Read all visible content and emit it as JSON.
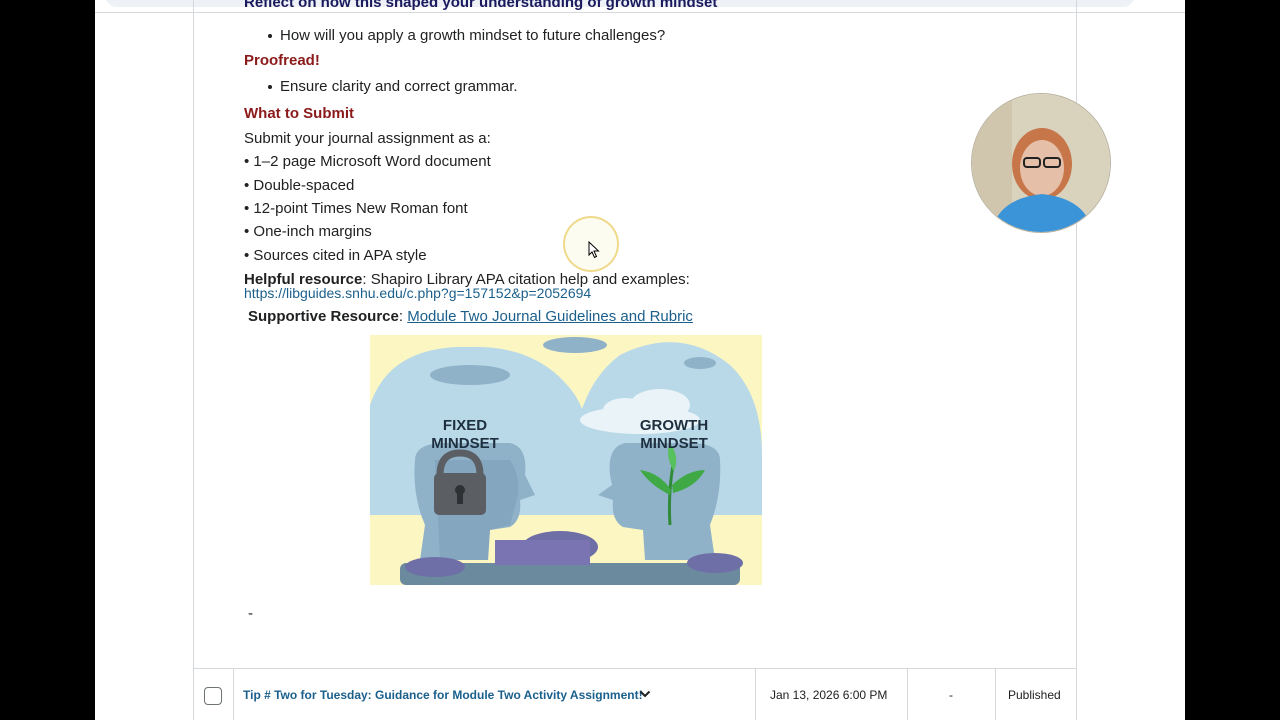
{
  "content": {
    "cut_heading": "Reflect on how this shaped your understanding of growth mindset",
    "reflect_bullet": "How will you apply a growth mindset to future challenges?",
    "proofread_heading": "Proofread!",
    "proofread_bullet": "Ensure clarity and correct grammar.",
    "submit_heading": "What to Submit",
    "submit_intro": "Submit your journal assignment as a:",
    "submit_items": [
      "• 1–2 page Microsoft Word document",
      "• Double-spaced",
      "• 12-point Times New Roman font",
      "• One-inch margins",
      "• Sources cited in APA style"
    ],
    "helpful_label": "Helpful resource",
    "helpful_text": ": Shapiro Library APA citation help and examples:",
    "helpful_link": "https://libguides.snhu.edu/c.php?g=157152&p=2052694",
    "supportive_label": "Supportive Resource",
    "supportive_sep": ": ",
    "supportive_link": "Module Two Journal Guidelines and Rubric",
    "dash": "-"
  },
  "image": {
    "fixed_text_line1": "FIXED",
    "fixed_text_line2": "MINDSET",
    "growth_text_line1": "GROWTH",
    "growth_text_line2": "MINDSET",
    "colors": {
      "background": "#fbf6c2",
      "sky": "#b9d9e8",
      "head": "#8fb2c9",
      "lock": "#5b5f63",
      "plant": "#3faa45"
    }
  },
  "row": {
    "title": "Tip # Two for Tuesday: Guidance for Module Two Activity Assignment!",
    "date": "Jan 13, 2026 6:00 PM",
    "dash": "-",
    "status": "Published"
  },
  "colors": {
    "heading_red": "#8b1a1a",
    "link_blue": "#1b5f8c",
    "border": "#d6d9dc"
  }
}
